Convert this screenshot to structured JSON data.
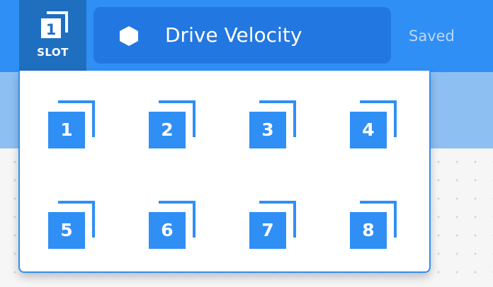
{
  "header": {
    "slot_button": {
      "number": "1",
      "label": "SLOT",
      "icon": "slot-icon"
    },
    "project": {
      "icon": "hexagon-icon",
      "name": "Drive Velocity"
    },
    "save_status": "Saved"
  },
  "slot_menu": {
    "slots": [
      {
        "number": "1"
      },
      {
        "number": "2"
      },
      {
        "number": "3"
      },
      {
        "number": "4"
      },
      {
        "number": "5"
      },
      {
        "number": "6"
      },
      {
        "number": "7"
      },
      {
        "number": "8"
      }
    ]
  },
  "colors": {
    "header_blue": "#2f8ff5",
    "header_selected": "#1f6fc1",
    "title_box": "#2377e0",
    "slot_icon_blue": "#2f8ff5"
  }
}
